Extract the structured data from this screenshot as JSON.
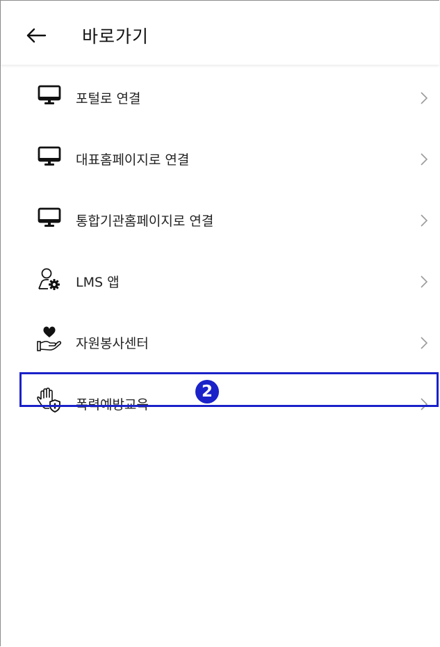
{
  "header": {
    "title": "바로가기",
    "back_icon": "arrow-left-icon"
  },
  "menu": {
    "items": [
      {
        "label": "포털로 연결",
        "icon": "monitor-icon"
      },
      {
        "label": "대표홈페이지로 연결",
        "icon": "monitor-icon"
      },
      {
        "label": "통합기관홈페이지로 연결",
        "icon": "monitor-icon"
      },
      {
        "label": "LMS 앱",
        "icon": "user-gear-icon"
      },
      {
        "label": "자원봉사센터",
        "icon": "heart-hand-icon"
      },
      {
        "label": "폭력예방교육",
        "icon": "hand-shield-icon"
      }
    ],
    "chevron_icon": "chevron-right-icon"
  },
  "annotation": {
    "step_number": "2",
    "highlight_color": "#1a22c8"
  }
}
